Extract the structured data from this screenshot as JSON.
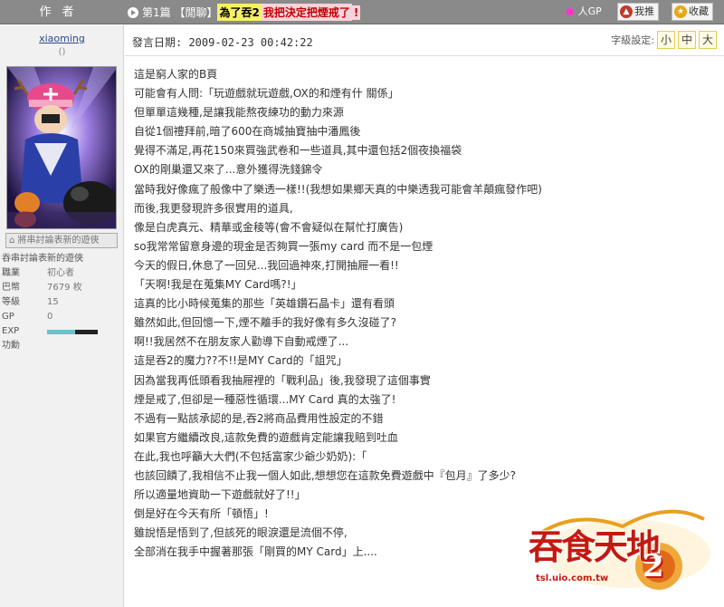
{
  "header": {
    "author_label": "作者",
    "title_prefix": "第1篇 【閒聊】",
    "title_highlight1": "為了吞2",
    "title_highlight2": "我把決定把煙戒了",
    "title_suffix": "!",
    "gp_label": "人GP",
    "recommend_label": "我推",
    "favorite_label": "收藏"
  },
  "author": {
    "username": "xiaoming",
    "sub": "()",
    "avatar_button": "將串討論表新的遊俠",
    "tagline": "吞串討論表新的遊俠",
    "stats": [
      {
        "key": "職業",
        "value": "初心者"
      },
      {
        "key": "巴幣",
        "value": "7679 枚"
      },
      {
        "key": "等級",
        "value": "15"
      },
      {
        "key": "GP",
        "value": "0"
      },
      {
        "key": "EXP",
        "value": ""
      },
      {
        "key": "功勳",
        "value": ""
      }
    ],
    "exp_fraction": 0.55
  },
  "post": {
    "date_label": "發言日期: 2009-02-23 00:42:22",
    "font_size_label": "字級設定:",
    "font_sizes": [
      "小",
      "中",
      "大"
    ],
    "lines": [
      "這是窮人家的B頁",
      "可能會有人問:「玩遊戲就玩遊戲,OX的和煙有什 關係」",
      "但單單這幾種,是讓我能熬夜練功的動力來源",
      "自從1個禮拜前,暗了600在商城抽寶抽中潘鳳後",
      "覺得不滿足,再花150來買強武卷和一些道具,其中還包括2個夜換福袋",
      "OX的剛巢還又來了...意外獲得洗錢錦令",
      "當時我好像瘋了般像中了樂透一樣!!(我想如果鄉天真的中樂透我可能會羊顛瘋發作吧)",
      "而後,我更發現許多很實用的道具,",
      "像是白虎真元、精華或金稜等(會不會疑似在幫忙打廣告)",
      "so我常常留意身邊的現金是否夠買一張my card 而不是一包煙",
      "今天的假日,休息了一回兒...我回過神來,打開抽屜一看!!",
      "「天啊!我是在蒐集MY Card嗎?!」",
      "這真的比小時候蒐集的那些「英雄鑽石晶卡」還有看頭",
      "雖然如此,但回憶一下,煙不離手的我好像有多久沒碰了?",
      "啊!!我居然不在朋友家人勸導下自動戒煙了...",
      "這是吞2的魔力??不!!是MY Card的「詛咒」",
      "因為當我再低頭看我抽屜裡的「戰利品」後,我發現了這個事實",
      "煙是戒了,但卻是一種惡性循環...MY Card 真的太強了!",
      "不過有一點該承認的是,吞2將商品費用性設定的不錯",
      "如果官方繼續改良,這款免費的遊戲肯定能讓我賠到吐血",
      "在此,我也呼籲大大們(不包括富家少爺少奶奶):「",
      "也該回饋了,我相信不止我一個人如此,想想您在這款免費遊戲中『包月』了多少?",
      "所以適量地資助一下遊戲就好了!!」",
      "倒是好在今天有所「頓悟」!",
      "雖說悟是悟到了,但該死的眼淚還是流個不停,",
      "全部消在我手中握著那張「剛買的MY Card」上...."
    ]
  },
  "logo": {
    "text": "吞食天地",
    "numeral": "2",
    "url_text": "tsl.uio.com.tw"
  },
  "colors": {
    "header_bg": "#8a8a8a",
    "left_bg": "#f1f1f1",
    "highlight_yellow": "#f5f067",
    "highlight_pink": "#f9d3dc",
    "title_red": "#c00000",
    "logo_red": "#c21a12",
    "logo_gold": "#e8a020"
  }
}
